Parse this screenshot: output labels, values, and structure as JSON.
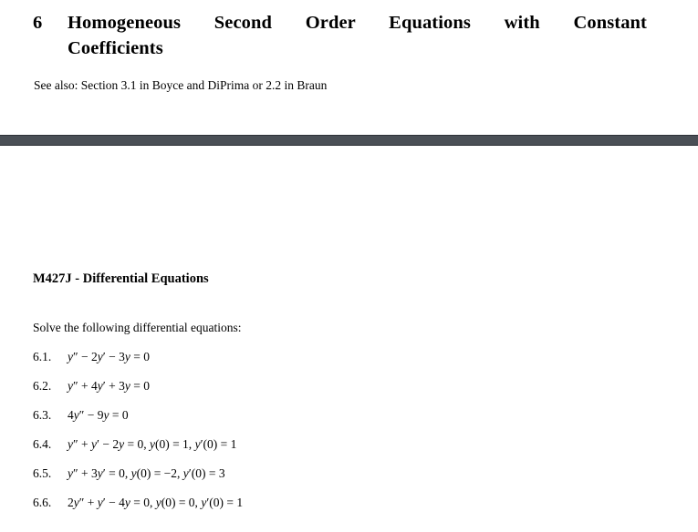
{
  "document": {
    "section_number": "6",
    "section_title_line1": "Homogeneous Second Order Equations with Constant",
    "section_title_line2": "Coefficients",
    "see_also": "See also: Section 3.1 in Boyce and DiPrima or 2.2 in Braun",
    "course_title": "M427J - Differential Equations",
    "instruction": "Solve the following differential equations:",
    "problems": [
      {
        "number": "6.1.",
        "equation": "y'' − 2y' − 3y = 0"
      },
      {
        "number": "6.2.",
        "equation": "y'' + 4y' + 3y = 0"
      },
      {
        "number": "6.3.",
        "equation": "4y'' − 9y = 0"
      },
      {
        "number": "6.4.",
        "equation": "y'' + y' − 2y = 0, y(0) = 1, y'(0) = 1"
      },
      {
        "number": "6.5.",
        "equation": "y'' + 3y' = 0, y(0) = −2, y'(0) = 3"
      },
      {
        "number": "6.6.",
        "equation": "2y'' + y' − 4y = 0, y(0) = 0, y'(0) = 1"
      }
    ]
  },
  "colors": {
    "divider": "#4a4f56",
    "page_background": "#ffffff",
    "text": "#000000"
  }
}
